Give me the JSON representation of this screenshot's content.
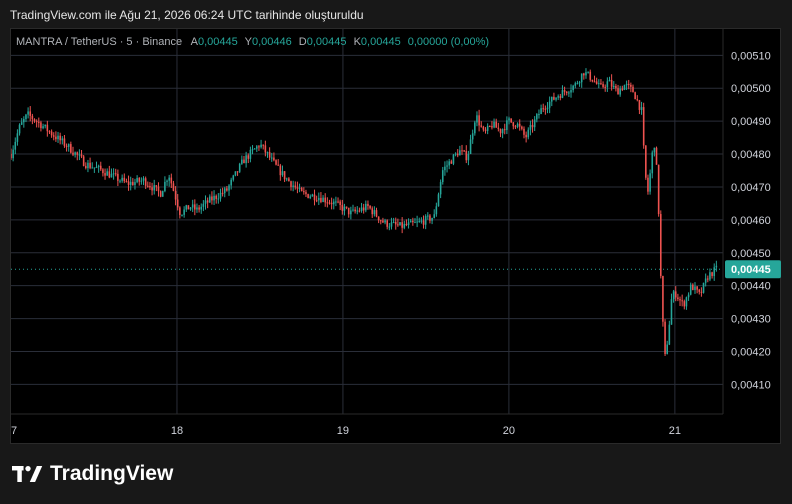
{
  "caption": "TradingView.com ile Ağu 21, 2026 06:24 UTC tarihinde oluşturuldu",
  "legend": {
    "symbol": "MANTRA / TetherUS · 5 · Binance",
    "open_label": "A",
    "open": "0,00445",
    "high_label": "Y",
    "high": "0,00446",
    "low_label": "D",
    "low": "0,00445",
    "close_label": "K",
    "close": "0,00445",
    "change": "0,00000 (0,00%)"
  },
  "brand": {
    "name": "TradingView",
    "logo_icon": "tradingview-logo-icon"
  },
  "colors": {
    "up": "#26a69a",
    "down": "#ef5350",
    "grid": "#2a2e39",
    "price_tag": "#26a69a",
    "axis_text": "#d1d4dc",
    "background": "#000000"
  },
  "chart_data": {
    "type": "candlestick",
    "interval": "5",
    "exchange": "Binance",
    "pair": "MANTRA / TetherUS",
    "x_tick_labels": [
      "7",
      "18",
      "19",
      "20",
      "21"
    ],
    "y_tick_labels": [
      "0,00510",
      "0,00500",
      "0,00490",
      "0,00480",
      "0,00470",
      "0,00460",
      "0,00450",
      "0,00440",
      "0,00430",
      "0,00420",
      "0,00410"
    ],
    "y_ticks": [
      0.0051,
      0.005,
      0.0049,
      0.0048,
      0.0047,
      0.0046,
      0.0045,
      0.0044,
      0.0043,
      0.0042,
      0.0041
    ],
    "ylim": [
      0.00401,
      0.00518
    ],
    "xlim": [
      17.0,
      21.29
    ],
    "last_price": 0.00445,
    "last_price_label": "0,00445",
    "grid": true,
    "series": [
      {
        "name": "close",
        "x": [
          17.0,
          17.05,
          17.1,
          17.18,
          17.25,
          17.35,
          17.45,
          17.55,
          17.7,
          17.8,
          17.9,
          17.95,
          18.02,
          18.08,
          18.12,
          18.2,
          18.3,
          18.4,
          18.5,
          18.6,
          18.65,
          18.75,
          18.85,
          18.95,
          19.05,
          19.15,
          19.25,
          19.35,
          19.45,
          19.55,
          19.6,
          19.65,
          19.7,
          19.75,
          19.8,
          19.85,
          19.9,
          19.95,
          20.0,
          20.05,
          20.1,
          20.2,
          20.3,
          20.4,
          20.45,
          20.5,
          20.55,
          20.6,
          20.65,
          20.7,
          20.75,
          20.8,
          20.82,
          20.84,
          20.86,
          20.88,
          20.9,
          20.92,
          20.94,
          20.96,
          20.98,
          21.0,
          21.05,
          21.1,
          21.15,
          21.2,
          21.25
        ],
        "y": [
          0.0048,
          0.00488,
          0.00492,
          0.00489,
          0.00486,
          0.00482,
          0.00477,
          0.00475,
          0.00471,
          0.00472,
          0.00468,
          0.00474,
          0.00462,
          0.00464,
          0.00463,
          0.00466,
          0.00469,
          0.00478,
          0.00483,
          0.00476,
          0.00473,
          0.00468,
          0.00467,
          0.00465,
          0.00462,
          0.00464,
          0.00459,
          0.00458,
          0.00459,
          0.00461,
          0.00475,
          0.00478,
          0.00481,
          0.00479,
          0.00492,
          0.00486,
          0.00489,
          0.00487,
          0.0049,
          0.00489,
          0.00485,
          0.00494,
          0.00498,
          0.00501,
          0.00505,
          0.00503,
          0.005,
          0.00502,
          0.00499,
          0.00501,
          0.00499,
          0.00493,
          0.00474,
          0.00468,
          0.00479,
          0.00484,
          0.00466,
          0.00435,
          0.00418,
          0.00425,
          0.00436,
          0.00438,
          0.00434,
          0.0044,
          0.00437,
          0.00443,
          0.00445
        ]
      }
    ]
  }
}
